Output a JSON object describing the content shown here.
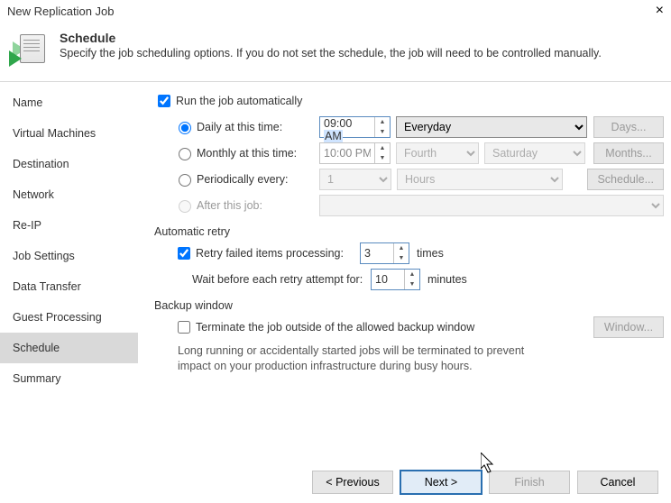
{
  "window": {
    "title": "New Replication Job"
  },
  "header": {
    "heading": "Schedule",
    "description": "Specify the job scheduling options. If you do not set the schedule, the job will need to be controlled manually."
  },
  "nav": {
    "items": [
      {
        "label": "Name"
      },
      {
        "label": "Virtual Machines"
      },
      {
        "label": "Destination"
      },
      {
        "label": "Network"
      },
      {
        "label": "Re-IP"
      },
      {
        "label": "Job Settings"
      },
      {
        "label": "Data Transfer"
      },
      {
        "label": "Guest Processing"
      },
      {
        "label": "Schedule"
      },
      {
        "label": "Summary"
      }
    ],
    "active_index": 8
  },
  "schedule": {
    "run_auto_label": "Run the job automatically",
    "run_auto_checked": true,
    "daily": {
      "label": "Daily at this time:",
      "time_hhmm": "09:00",
      "time_ampm": "AM",
      "recurrence": "Everyday",
      "button": "Days..."
    },
    "monthly": {
      "label": "Monthly at this time:",
      "time": "10:00 PM",
      "ordinal": "Fourth",
      "day": "Saturday",
      "button": "Months..."
    },
    "periodic": {
      "label": "Periodically every:",
      "value": "1",
      "unit": "Hours",
      "button": "Schedule..."
    },
    "after": {
      "label": "After this job:"
    }
  },
  "retry": {
    "group_label": "Automatic retry",
    "enabled_label": "Retry failed items processing:",
    "enabled_checked": true,
    "count": "3",
    "count_unit": "times",
    "wait_label": "Wait before each retry attempt for:",
    "wait_value": "10",
    "wait_unit": "minutes"
  },
  "window_group": {
    "group_label": "Backup window",
    "terminate_label": "Terminate the job outside of the allowed backup window",
    "terminate_checked": false,
    "button": "Window...",
    "note": "Long running or accidentally started jobs will be terminated to prevent impact on your production infrastructure during busy hours."
  },
  "footer": {
    "previous": "< Previous",
    "next": "Next >",
    "finish": "Finish",
    "cancel": "Cancel"
  }
}
